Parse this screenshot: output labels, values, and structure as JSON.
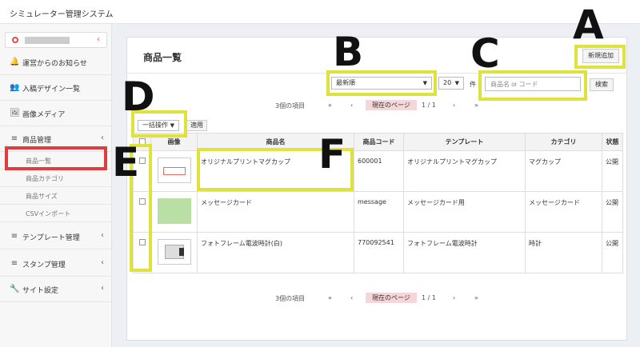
{
  "app": {
    "title": "シミュレーター管理システム"
  },
  "sidebar": {
    "items": [
      {
        "icon": "bell-icon",
        "glyph": "🔔",
        "label": "運営からのお知らせ",
        "chev": ""
      },
      {
        "icon": "users-icon",
        "glyph": "👥",
        "label": "入稿デザイン一覧",
        "chev": ""
      },
      {
        "icon": "image-icon",
        "glyph": "🖼",
        "label": "画像メディア",
        "chev": ""
      },
      {
        "icon": "database-icon",
        "glyph": "≡",
        "label": "商品管理",
        "chev": "‹"
      },
      {
        "icon": "database-icon",
        "glyph": "≡",
        "label": "テンプレート管理",
        "chev": "‹"
      },
      {
        "icon": "database-icon",
        "glyph": "≡",
        "label": "スタンプ管理",
        "chev": "‹"
      },
      {
        "icon": "wrench-icon",
        "glyph": "🔧",
        "label": "サイト設定",
        "chev": "‹"
      }
    ],
    "sub_items": [
      "商品一覧",
      "商品カテゴリ",
      "商品サイズ",
      "CSVインポート"
    ],
    "user_chev": "‹"
  },
  "main": {
    "title": "商品一覧",
    "new_button": "新規追加",
    "sort_select": "最新順",
    "per_page": "20",
    "per_page_unit": "件",
    "search_placeholder": "商品名 or コード",
    "search_button": "検索",
    "bulk_select": "一括操作",
    "apply_button": "適用",
    "pager": {
      "count": "3個の項目",
      "first": "«",
      "prev": "‹",
      "current": "現在のページ",
      "page": "1 / 1",
      "next": "›",
      "last": "»"
    },
    "columns": [
      "画像",
      "商品名",
      "商品コード",
      "テンプレート",
      "カテゴリ",
      "状態"
    ],
    "rows": [
      {
        "name": "オリジナルプリントマグカップ",
        "code": "600001",
        "template": "オリジナルプリントマグカップ",
        "category": "マグカップ",
        "status": "公開",
        "thumb": "mug"
      },
      {
        "name": "メッセージカード",
        "code": "message",
        "template": "メッセージカード用",
        "category": "メッセージカード",
        "status": "公開",
        "thumb": "card"
      },
      {
        "name": "フォトフレーム電波時計(白)",
        "code": "770092541",
        "template": "フォトフレーム電波時計",
        "category": "時計",
        "status": "公開",
        "thumb": "clock"
      }
    ]
  },
  "annotations": {
    "a": "A",
    "b": "B",
    "c": "C",
    "d": "D",
    "e": "E",
    "f": "F"
  },
  "colors": {
    "highlight": "#dfe23a",
    "active_box": "#e03e3e",
    "current_page_bg": "#f6d6d8"
  }
}
